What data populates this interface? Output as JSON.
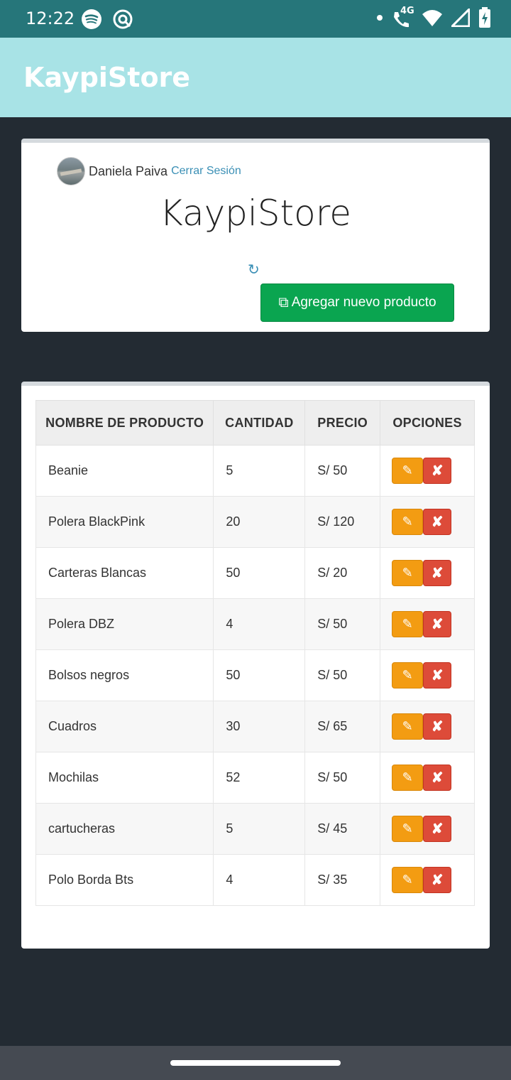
{
  "status_bar": {
    "time": "12:22",
    "network": "4G",
    "icons_left": [
      "spotify-icon",
      "sync-icon"
    ],
    "icons_right": [
      "dot-icon",
      "call-wifi-icon",
      "wifi-icon",
      "signal-icon",
      "battery-charging-icon"
    ]
  },
  "app_bar": {
    "title": "KaypiStore"
  },
  "user": {
    "name": "Daniela Paiva",
    "logout_label": "Cerrar Sesión"
  },
  "header": {
    "title": "KaypiStore",
    "add_button_label": "Agregar nuevo producto"
  },
  "table": {
    "headers": [
      "NOMBRE DE PRODUCTO",
      "CANTIDAD",
      "PRECIO",
      "OPCIONES"
    ],
    "rows": [
      {
        "name": "Beanie",
        "qty": "5",
        "price": "S/ 50"
      },
      {
        "name": "Polera BlackPink",
        "qty": "20",
        "price": "S/ 120"
      },
      {
        "name": "Carteras Blancas",
        "qty": "50",
        "price": "S/ 20"
      },
      {
        "name": "Polera DBZ",
        "qty": "4",
        "price": "S/ 50"
      },
      {
        "name": "Bolsos negros",
        "qty": "50",
        "price": "S/ 50"
      },
      {
        "name": "Cuadros",
        "qty": "30",
        "price": "S/ 65"
      },
      {
        "name": "Mochilas",
        "qty": "52",
        "price": "S/ 50"
      },
      {
        "name": "cartucheras",
        "qty": "5",
        "price": "S/ 45"
      },
      {
        "name": "Polo Borda Bts",
        "qty": "4",
        "price": "S/ 35"
      }
    ]
  },
  "colors": {
    "status_bar": "#26767a",
    "app_bar": "#a8e3e6",
    "background": "#232b33",
    "add_button": "#0aa550",
    "edit_button": "#f39c12",
    "delete_button": "#dd4b39",
    "link": "#3a8fb5"
  }
}
